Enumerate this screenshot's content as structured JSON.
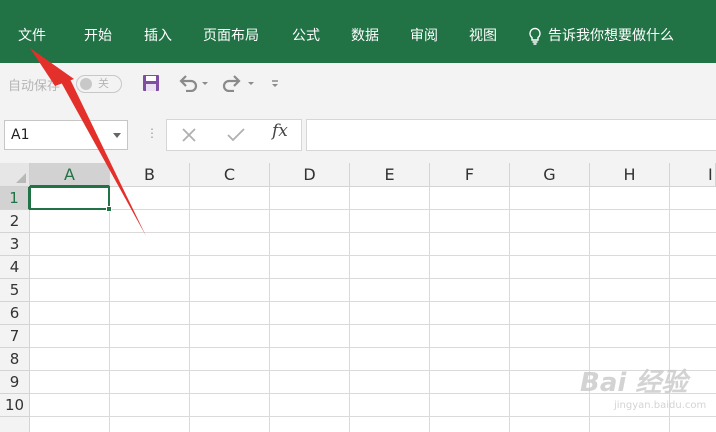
{
  "ribbon": {
    "tabs": [
      {
        "label": "文件"
      },
      {
        "label": "开始"
      },
      {
        "label": "插入"
      },
      {
        "label": "页面布局"
      },
      {
        "label": "公式"
      },
      {
        "label": "数据"
      },
      {
        "label": "审阅"
      },
      {
        "label": "视图"
      }
    ],
    "tell_me": "告诉我你想要做什么",
    "accent_color": "#217346"
  },
  "qat": {
    "autosave_label": "自动保存",
    "autosave_state": "关",
    "icons": [
      "save-icon",
      "undo-icon",
      "redo-icon",
      "customize-icon"
    ]
  },
  "formula_bar": {
    "name_box": "A1",
    "fx_label": "fx",
    "formula": ""
  },
  "sheet": {
    "columns": [
      "A",
      "B",
      "C",
      "D",
      "E",
      "F",
      "G",
      "H",
      "I"
    ],
    "rows": [
      "1",
      "2",
      "3",
      "4",
      "5",
      "6",
      "7",
      "8",
      "9",
      "10"
    ],
    "selected_cell": "A1"
  },
  "watermark": {
    "brand": "Bai 经验",
    "url": "jingyan.baidu.com"
  }
}
